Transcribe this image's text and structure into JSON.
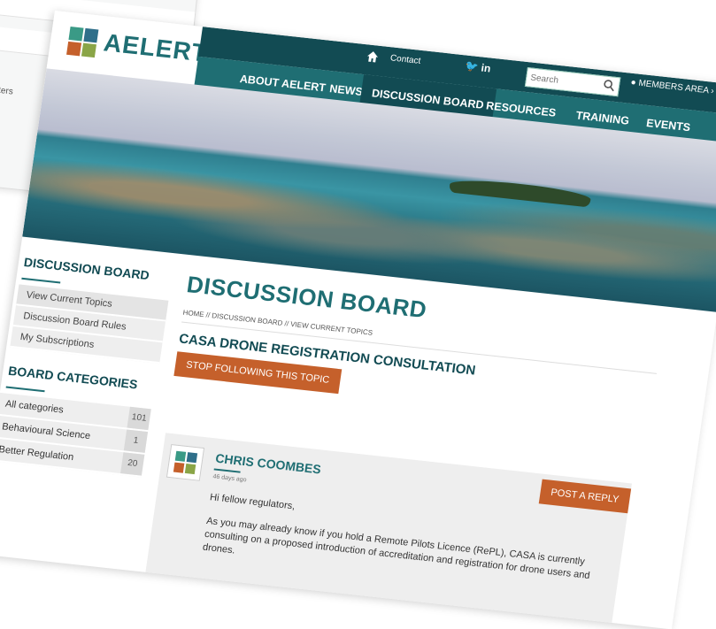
{
  "background_window": {
    "row_text": "atters"
  },
  "brand": {
    "name": "AELERT"
  },
  "top_bar": {
    "contact": "Contact",
    "search_placeholder": "Search",
    "members_area": "MEMBERS AREA ›"
  },
  "nav": [
    "ABOUT AELERT",
    "NEWS",
    "DISCUSSION BOARD",
    "RESOURCES",
    "TRAINING",
    "EVENTS"
  ],
  "sidebar": {
    "heading": "DISCUSSION BOARD",
    "links": [
      "View Current Topics",
      "Discussion Board Rules",
      "My Subscriptions"
    ],
    "categories_heading": "BOARD CATEGORIES",
    "categories": [
      {
        "label": "All categories",
        "count": "101"
      },
      {
        "label": "Behavioural Science",
        "count": "1"
      },
      {
        "label": "Better Regulation",
        "count": "20"
      }
    ]
  },
  "main": {
    "title": "DISCUSSION BOARD",
    "breadcrumb": "HOME // DISCUSSION BOARD // VIEW CURRENT TOPICS",
    "topic_title": "CASA DRONE REGISTRATION CONSULTATION",
    "stop_following": "STOP FOLLOWING THIS TOPIC",
    "post": {
      "author": "CHRIS COOMBES",
      "time_ago": "46 days ago",
      "post_reply": "POST A REPLY",
      "greeting": "Hi fellow regulators,",
      "body": "As you may already know if you hold a Remote Pilots Licence (RePL), CASA is currently consulting on a proposed introduction of accreditation and registration for drone users and drones."
    }
  },
  "colors": {
    "teal": "#1f6e73",
    "teal_dark": "#124b53",
    "orange": "#c5602b"
  },
  "icons": [
    "home-icon",
    "twitter-icon",
    "linkedin-icon",
    "search-icon",
    "user-icon",
    "logo-icon"
  ]
}
